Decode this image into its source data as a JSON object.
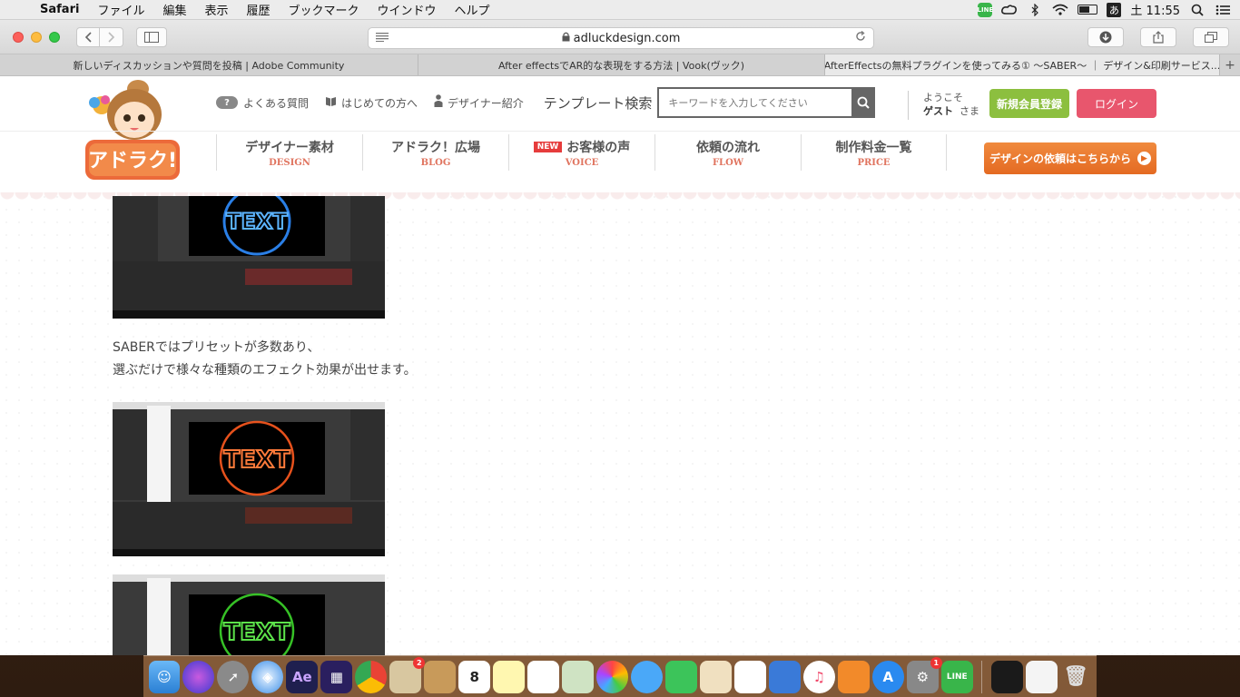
{
  "menubar": {
    "app": "Safari",
    "items": [
      "ファイル",
      "編集",
      "表示",
      "履歴",
      "ブックマーク",
      "ウインドウ",
      "ヘルプ"
    ],
    "clock": "土 11:55",
    "ime": "あ",
    "line_label": "LINE"
  },
  "browser": {
    "url": "adluckdesign.com",
    "tabs": [
      "新しいディスカッションや質問を投稿 | Adobe Community",
      "After effectsでAR的な表現をする方法 | Vook(ヴック)",
      "AfterEffectsの無料プラグインを使ってみる① 〜SABER〜 ｜ デザイン&印刷サービス..."
    ]
  },
  "site": {
    "topnav": {
      "faq": "よくある質問",
      "beginner": "はじめての方へ",
      "designers": "デザイナー紹介",
      "template_search": "テンプレート検索",
      "search_placeholder": "キーワードを入力してください"
    },
    "welcome_line1": "ようこそ",
    "welcome_guest": "ゲスト",
    "welcome_suffix": "さま",
    "register": "新規会員登録",
    "login": "ログイン",
    "mainnav": [
      {
        "title": "デザイナー素材",
        "sub": "DESIGN"
      },
      {
        "title": "アドラク！広場",
        "sub": "BLOG"
      },
      {
        "title": "お客様の声",
        "sub": "VOICE",
        "badge": "NEW"
      },
      {
        "title": "依頼の流れ",
        "sub": "FLOW"
      },
      {
        "title": "制作料金一覧",
        "sub": "PRICE"
      }
    ],
    "cta": "デザインの依頼はこちらから",
    "logo_text": "アドラク!"
  },
  "article": {
    "para_line1": "SABERではプリセットが多数あり、",
    "para_line2": "選ぶだけで様々な種類のエフェクト効果が出せます。",
    "shot_text": "TEXT",
    "glow_colors": [
      "#2f8dff",
      "#ff5a1f",
      "#3cd62a"
    ]
  },
  "dock": {
    "calendar_day": "8",
    "badge_mail": "2",
    "badge_prefs": "1",
    "ae_label": "Ae"
  }
}
